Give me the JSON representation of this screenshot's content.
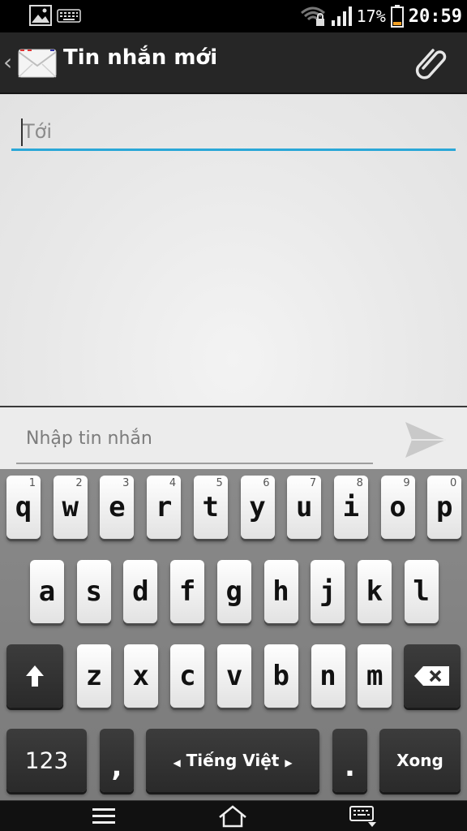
{
  "status_bar": {
    "left_icons": [
      "image-icon",
      "keyboard-icon"
    ],
    "right_icons": [
      "wifi-icon",
      "signal-icon",
      "battery-icon"
    ],
    "battery_percent": "17%",
    "time": "20:59"
  },
  "action_bar": {
    "title": "Tin nhắn mới",
    "back_icon": "chevron-left-icon",
    "app_icon": "envelope-icon",
    "attach_icon": "paperclip-icon"
  },
  "recipient": {
    "placeholder": "Tới",
    "value": ""
  },
  "compose": {
    "placeholder": "Nhập tin nhắn",
    "value": "",
    "send_icon": "send-icon"
  },
  "keyboard": {
    "row1": [
      {
        "label": "q",
        "hint": "1"
      },
      {
        "label": "w",
        "hint": "2"
      },
      {
        "label": "e",
        "hint": "3"
      },
      {
        "label": "r",
        "hint": "4"
      },
      {
        "label": "t",
        "hint": "5"
      },
      {
        "label": "y",
        "hint": "6"
      },
      {
        "label": "u",
        "hint": "7"
      },
      {
        "label": "i",
        "hint": "8"
      },
      {
        "label": "o",
        "hint": "9"
      },
      {
        "label": "p",
        "hint": "0"
      }
    ],
    "row2": [
      {
        "label": "a"
      },
      {
        "label": "s"
      },
      {
        "label": "d"
      },
      {
        "label": "f"
      },
      {
        "label": "g"
      },
      {
        "label": "h"
      },
      {
        "label": "j"
      },
      {
        "label": "k"
      },
      {
        "label": "l"
      }
    ],
    "row3": [
      {
        "label": "z"
      },
      {
        "label": "x"
      },
      {
        "label": "c"
      },
      {
        "label": "v"
      },
      {
        "label": "b"
      },
      {
        "label": "n"
      },
      {
        "label": "m"
      }
    ],
    "shift_icon": "shift-arrow-icon",
    "backspace_icon": "backspace-icon",
    "numbers_label": "123",
    "comma_label": ",",
    "space_label": "Tiếng Việt",
    "period_label": ".",
    "done_label": "Xong"
  },
  "nav_bar": {
    "menu_icon": "menu-icon",
    "home_icon": "home-icon",
    "hide_keyboard_icon": "keyboard-hide-icon"
  }
}
